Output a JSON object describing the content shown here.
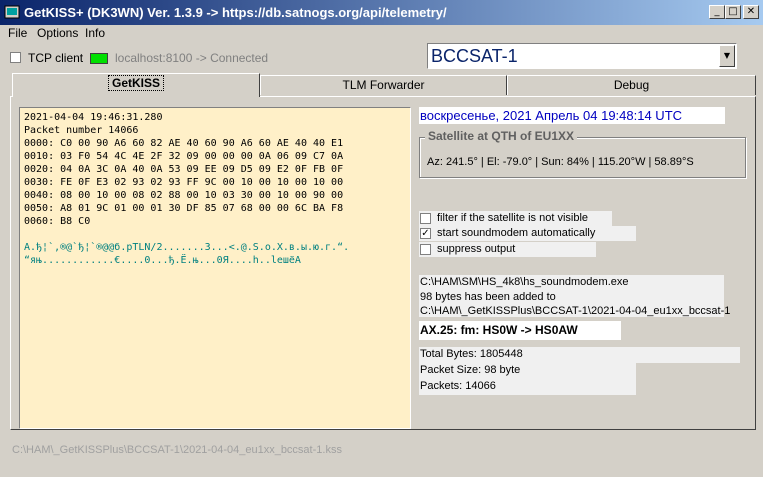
{
  "window": {
    "title": "GetKISS+ (DK3WN) Ver. 1.3.9 -> https://db.satnogs.org/api/telemetry/",
    "minimize_glyph": "_",
    "maximize_glyph": "□",
    "close_glyph": "✕"
  },
  "menu": {
    "file": "File",
    "options": "Options",
    "info": "Info"
  },
  "connection": {
    "tcp_label": "TCP client",
    "tcp_checked": false,
    "status_text": "localhost:8100 -> Connected",
    "led_color": "#00e000"
  },
  "satellite_select": {
    "value": "BCCSAT-1"
  },
  "tabs": [
    {
      "label": "GetKISS",
      "active": true
    },
    {
      "label": "TLM Forwarder",
      "active": false
    },
    {
      "label": "Debug",
      "active": false
    }
  ],
  "hexdump": {
    "lines": [
      "2021-04-04 19:46:31.280",
      "Packet number 14066",
      "0000: C0 00 90 A6 60 82 AE 40 60 90 A6 60 AE 40 40 E1",
      "0010: 03 F0 54 4C 4E 2F 32 09 00 00 00 0A 06 09 C7 0A",
      "0020: 04 0A 3C 0A 40 0A 53 09 EE 09 D5 09 E2 0F FB 0F",
      "0030: FE 0F E3 02 93 02 93 FF 9C 00 10 00 10 00 10 00",
      "0040: 08 00 10 00 08 02 88 00 10 03 30 00 10 00 90 00",
      "0050: A8 01 9C 01 00 01 30 DF 85 07 68 00 00 6C BA F8",
      "0060: B8 C0"
    ],
    "ascii_lines": [
      "А.ђ¦`,®@`ђ¦`®@@б.pTLN/2.......З...<.@.S.о.Х.в.ы.ю.г.“.",
      "“яњ............€....0...ђ.Ё.њ...0Я....h..lешёА"
    ]
  },
  "datetime": "воскресенье, 2021 Апрель 04 19:48:14 UTC",
  "satellite_group": {
    "title": "Satellite at QTH of EU1XX",
    "info": "Az: 241.5° | El: -79.0° | Sun: 84% | 115.20°W | 58.89°S"
  },
  "options": {
    "filter_label": "filter if the satellite is not visible",
    "filter_checked": false,
    "soundmodem_label": "start soundmodem automatically",
    "soundmodem_checked": true,
    "suppress_label": "suppress output",
    "suppress_checked": false
  },
  "log": {
    "line1": "C:\\HAM\\SM\\HS_4k8\\hs_soundmodem.exe",
    "line2": "98 bytes has been added to",
    "line3": "C:\\HAM\\_GetKISSPlus\\BCCSAT-1\\2021-04-04_eu1xx_bccsat-1"
  },
  "ax25": {
    "text": "AX.25: fm: HS0W    -> HS0AW"
  },
  "stats": {
    "total_bytes": "Total Bytes: 1805448",
    "packet_size": "Packet Size: 98 byte",
    "packets": "Packets: 14066"
  },
  "status_path": "C:\\HAM\\_GetKISSPlus\\BCCSAT-1\\2021-04-04_eu1xx_bccsat-1.kss"
}
